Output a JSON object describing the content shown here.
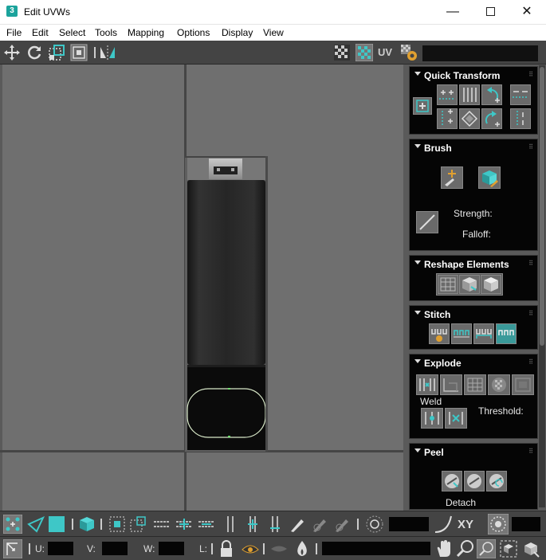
{
  "window": {
    "app_icon": "3",
    "title": "Edit UVWs",
    "minimize_glyph": "—",
    "close_glyph": "✕"
  },
  "menu": [
    "File",
    "Edit",
    "Select",
    "Tools",
    "Mapping",
    "Options",
    "Display",
    "View"
  ],
  "toolbar_top": {
    "uv_label": "UV",
    "icons": [
      "move-icon",
      "rotate-icon",
      "scale-icon",
      "freeform-icon",
      "mirror-icon",
      "checker-off-icon",
      "checker-on-icon",
      "uv-settings-icon"
    ]
  },
  "panel": {
    "quick_transform": {
      "title": "Quick Transform"
    },
    "brush": {
      "title": "Brush",
      "strength_label": "Strength:",
      "falloff_label": "Falloff:"
    },
    "reshape": {
      "title": "Reshape Elements"
    },
    "stitch": {
      "title": "Stitch"
    },
    "explode": {
      "title": "Explode",
      "weld_label": "Weld",
      "threshold_label": "Threshold:"
    },
    "peel": {
      "title": "Peel",
      "detach_label": "Detach"
    }
  },
  "bottom": {
    "u_label": "U:",
    "v_label": "V:",
    "w_label": "W:",
    "l_label": "L:",
    "xy_label": "XY"
  },
  "colors": {
    "accent": "#3ec7c7",
    "viewport": "#6f6f6f",
    "panel_bg": "#050505",
    "toolbar_bg": "#444444"
  }
}
